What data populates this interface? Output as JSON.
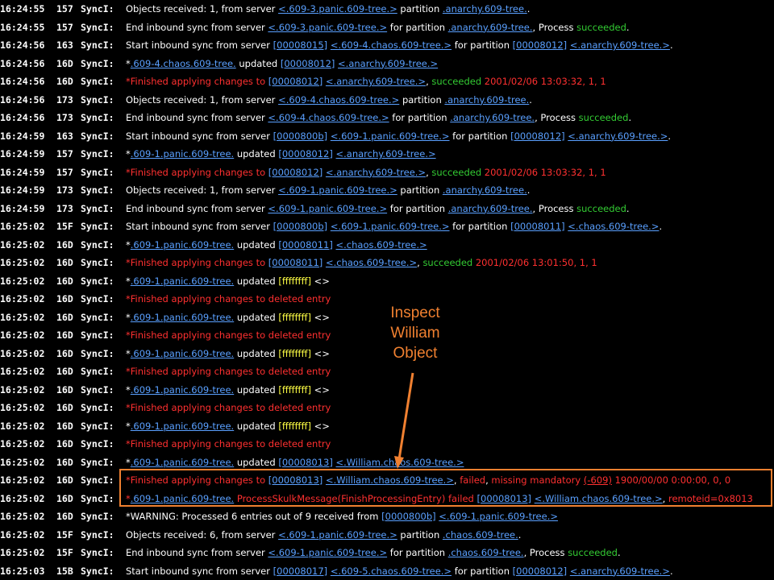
{
  "annotation": {
    "lines": [
      "Inspect",
      "William",
      "Object"
    ],
    "color": "#f08030"
  },
  "colors": {
    "link": "#5aa0ff",
    "error": "#ff3030",
    "success": "#33cc33",
    "hex": "#ffff44",
    "text": "#ffffff"
  },
  "log_rows": [
    {
      "time": "16:24:55",
      "id": "157",
      "src": "SyncI:",
      "msg": [
        [
          "w",
          "Objects received: 1, from server "
        ],
        [
          "l",
          "<.609-3.panic.609-tree.>"
        ],
        [
          "w",
          " partition "
        ],
        [
          "l",
          ".anarchy.609-tree."
        ],
        [
          "w",
          "."
        ]
      ]
    },
    {
      "time": "16:24:55",
      "id": "157",
      "src": "SyncI:",
      "msg": [
        [
          "w",
          "End inbound sync from server "
        ],
        [
          "l",
          "<.609-3.panic.609-tree.>"
        ],
        [
          "w",
          " for partition "
        ],
        [
          "l",
          ".anarchy.609-tree."
        ],
        [
          "w",
          ", Process "
        ],
        [
          "g",
          "succeeded"
        ],
        [
          "w",
          "."
        ]
      ]
    },
    {
      "time": "16:24:56",
      "id": "163",
      "src": "SyncI:",
      "msg": [
        [
          "w",
          "Start inbound sync from server "
        ],
        [
          "l",
          "[00008015]"
        ],
        [
          "w",
          " "
        ],
        [
          "l",
          "<.609-4.chaos.609-tree.>"
        ],
        [
          "w",
          " for partition "
        ],
        [
          "l",
          "[00008012]"
        ],
        [
          "w",
          " "
        ],
        [
          "l",
          "<.anarchy.609-tree.>"
        ],
        [
          "w",
          "."
        ]
      ]
    },
    {
      "time": "16:24:56",
      "id": "16D",
      "src": "SyncI:",
      "msg": [
        [
          "w",
          "*"
        ],
        [
          "l",
          ".609-4.chaos.609-tree."
        ],
        [
          "w",
          " updated "
        ],
        [
          "l",
          "[00008012]"
        ],
        [
          "w",
          " "
        ],
        [
          "l",
          "<.anarchy.609-tree.>"
        ]
      ]
    },
    {
      "time": "16:24:56",
      "id": "16D",
      "src": "SyncI:",
      "msg": [
        [
          "r",
          "*Finished applying changes to "
        ],
        [
          "l",
          "[00008012]"
        ],
        [
          "w",
          " "
        ],
        [
          "l",
          "<.anarchy.609-tree.>"
        ],
        [
          "w",
          ", "
        ],
        [
          "g",
          "succeeded"
        ],
        [
          "r",
          " 2001/02/06 13:03:32, 1, 1"
        ]
      ]
    },
    {
      "time": "16:24:56",
      "id": "173",
      "src": "SyncI:",
      "msg": [
        [
          "w",
          "Objects received: 1, from server "
        ],
        [
          "l",
          "<.609-4.chaos.609-tree.>"
        ],
        [
          "w",
          " partition "
        ],
        [
          "l",
          ".anarchy.609-tree."
        ],
        [
          "w",
          "."
        ]
      ]
    },
    {
      "time": "16:24:56",
      "id": "173",
      "src": "SyncI:",
      "msg": [
        [
          "w",
          "End inbound sync from server "
        ],
        [
          "l",
          "<.609-4.chaos.609-tree.>"
        ],
        [
          "w",
          " for partition "
        ],
        [
          "l",
          ".anarchy.609-tree."
        ],
        [
          "w",
          ", Process "
        ],
        [
          "g",
          "succeeded"
        ],
        [
          "w",
          "."
        ]
      ]
    },
    {
      "time": "16:24:59",
      "id": "163",
      "src": "SyncI:",
      "msg": [
        [
          "w",
          "Start inbound sync from server "
        ],
        [
          "l",
          "[0000800b]"
        ],
        [
          "w",
          " "
        ],
        [
          "l",
          "<.609-1.panic.609-tree.>"
        ],
        [
          "w",
          " for partition "
        ],
        [
          "l",
          "[00008012]"
        ],
        [
          "w",
          " "
        ],
        [
          "l",
          "<.anarchy.609-tree.>"
        ],
        [
          "w",
          "."
        ]
      ]
    },
    {
      "time": "16:24:59",
      "id": "157",
      "src": "SyncI:",
      "msg": [
        [
          "w",
          "*"
        ],
        [
          "l",
          ".609-1.panic.609-tree."
        ],
        [
          "w",
          " updated "
        ],
        [
          "l",
          "[00008012]"
        ],
        [
          "w",
          " "
        ],
        [
          "l",
          "<.anarchy.609-tree.>"
        ]
      ]
    },
    {
      "time": "16:24:59",
      "id": "157",
      "src": "SyncI:",
      "msg": [
        [
          "r",
          "*Finished applying changes to "
        ],
        [
          "l",
          "[00008012]"
        ],
        [
          "w",
          " "
        ],
        [
          "l",
          "<.anarchy.609-tree.>"
        ],
        [
          "w",
          ", "
        ],
        [
          "g",
          "succeeded"
        ],
        [
          "r",
          " 2001/02/06 13:03:32, 1, 1"
        ]
      ]
    },
    {
      "time": "16:24:59",
      "id": "173",
      "src": "SyncI:",
      "msg": [
        [
          "w",
          "Objects received: 1, from server "
        ],
        [
          "l",
          "<.609-1.panic.609-tree.>"
        ],
        [
          "w",
          " partition "
        ],
        [
          "l",
          ".anarchy.609-tree."
        ],
        [
          "w",
          "."
        ]
      ]
    },
    {
      "time": "16:24:59",
      "id": "173",
      "src": "SyncI:",
      "msg": [
        [
          "w",
          "End inbound sync from server "
        ],
        [
          "l",
          "<.609-1.panic.609-tree.>"
        ],
        [
          "w",
          " for partition "
        ],
        [
          "l",
          ".anarchy.609-tree."
        ],
        [
          "w",
          ", Process "
        ],
        [
          "g",
          "succeeded"
        ],
        [
          "w",
          "."
        ]
      ]
    },
    {
      "time": "16:25:02",
      "id": "15F",
      "src": "SyncI:",
      "msg": [
        [
          "w",
          "Start inbound sync from server "
        ],
        [
          "l",
          "[0000800b]"
        ],
        [
          "w",
          " "
        ],
        [
          "l",
          "<.609-1.panic.609-tree.>"
        ],
        [
          "w",
          " for partition "
        ],
        [
          "l",
          "[00008011]"
        ],
        [
          "w",
          " "
        ],
        [
          "l",
          "<.chaos.609-tree.>"
        ],
        [
          "w",
          "."
        ]
      ]
    },
    {
      "time": "16:25:02",
      "id": "16D",
      "src": "SyncI:",
      "msg": [
        [
          "w",
          "*"
        ],
        [
          "l",
          ".609-1.panic.609-tree."
        ],
        [
          "w",
          " updated "
        ],
        [
          "l",
          "[00008011]"
        ],
        [
          "w",
          " "
        ],
        [
          "l",
          "<.chaos.609-tree.>"
        ]
      ]
    },
    {
      "time": "16:25:02",
      "id": "16D",
      "src": "SyncI:",
      "msg": [
        [
          "r",
          "*Finished applying changes to "
        ],
        [
          "l",
          "[00008011]"
        ],
        [
          "w",
          " "
        ],
        [
          "l",
          "<.chaos.609-tree.>"
        ],
        [
          "w",
          ", "
        ],
        [
          "g",
          "succeeded"
        ],
        [
          "r",
          " 2001/02/06 13:01:50, 1, 1"
        ]
      ]
    },
    {
      "time": "16:25:02",
      "id": "16D",
      "src": "SyncI:",
      "msg": [
        [
          "w",
          "*"
        ],
        [
          "l",
          ".609-1.panic.609-tree."
        ],
        [
          "w",
          " updated "
        ],
        [
          "y",
          "[ffffffff]"
        ],
        [
          "w",
          " <>"
        ]
      ]
    },
    {
      "time": "16:25:02",
      "id": "16D",
      "src": "SyncI:",
      "msg": [
        [
          "r",
          "*Finished applying changes to deleted entry"
        ]
      ]
    },
    {
      "time": "16:25:02",
      "id": "16D",
      "src": "SyncI:",
      "msg": [
        [
          "w",
          "*"
        ],
        [
          "l",
          ".609-1.panic.609-tree."
        ],
        [
          "w",
          " updated "
        ],
        [
          "y",
          "[ffffffff]"
        ],
        [
          "w",
          " <>"
        ]
      ]
    },
    {
      "time": "16:25:02",
      "id": "16D",
      "src": "SyncI:",
      "msg": [
        [
          "r",
          "*Finished applying changes to deleted entry"
        ]
      ]
    },
    {
      "time": "16:25:02",
      "id": "16D",
      "src": "SyncI:",
      "msg": [
        [
          "w",
          "*"
        ],
        [
          "l",
          ".609-1.panic.609-tree."
        ],
        [
          "w",
          " updated "
        ],
        [
          "y",
          "[ffffffff]"
        ],
        [
          "w",
          " <>"
        ]
      ]
    },
    {
      "time": "16:25:02",
      "id": "16D",
      "src": "SyncI:",
      "msg": [
        [
          "r",
          "*Finished applying changes to deleted entry"
        ]
      ]
    },
    {
      "time": "16:25:02",
      "id": "16D",
      "src": "SyncI:",
      "msg": [
        [
          "w",
          "*"
        ],
        [
          "l",
          ".609-1.panic.609-tree."
        ],
        [
          "w",
          " updated "
        ],
        [
          "y",
          "[ffffffff]"
        ],
        [
          "w",
          " <>"
        ]
      ]
    },
    {
      "time": "16:25:02",
      "id": "16D",
      "src": "SyncI:",
      "msg": [
        [
          "r",
          "*Finished applying changes to deleted entry"
        ]
      ]
    },
    {
      "time": "16:25:02",
      "id": "16D",
      "src": "SyncI:",
      "msg": [
        [
          "w",
          "*"
        ],
        [
          "l",
          ".609-1.panic.609-tree."
        ],
        [
          "w",
          " updated "
        ],
        [
          "y",
          "[ffffffff]"
        ],
        [
          "w",
          " <>"
        ]
      ]
    },
    {
      "time": "16:25:02",
      "id": "16D",
      "src": "SyncI:",
      "msg": [
        [
          "r",
          "*Finished applying changes to deleted entry"
        ]
      ]
    },
    {
      "time": "16:25:02",
      "id": "16D",
      "src": "SyncI:",
      "msg": [
        [
          "w",
          "*"
        ],
        [
          "l",
          ".609-1.panic.609-tree."
        ],
        [
          "w",
          " updated "
        ],
        [
          "l",
          "[00008013]"
        ],
        [
          "w",
          " "
        ],
        [
          "l",
          "<.William.chaos.609-tree.>"
        ]
      ]
    },
    {
      "time": "16:25:02",
      "id": "16D",
      "src": "SyncI:",
      "msg": [
        [
          "r",
          "*Finished applying changes to "
        ],
        [
          "l",
          "[00008013]"
        ],
        [
          "w",
          " "
        ],
        [
          "l",
          "<.William.chaos.609-tree.>"
        ],
        [
          "w",
          ", "
        ],
        [
          "r",
          "failed"
        ],
        [
          "w",
          ", "
        ],
        [
          "r",
          "missing mandatory "
        ],
        [
          "ru",
          "(-609)"
        ],
        [
          "r",
          " 1900/00/00 0:00:00, 0, 0"
        ]
      ]
    },
    {
      "time": "16:25:02",
      "id": "16D",
      "src": "SyncI:",
      "msg": [
        [
          "r",
          "*"
        ],
        [
          "l",
          ".609-1.panic.609-tree."
        ],
        [
          "r",
          " ProcessSkulkMessage(FinishProcessingEntry) failed "
        ],
        [
          "l",
          "[00008013]"
        ],
        [
          "w",
          " "
        ],
        [
          "l",
          "<.William.chaos.609-tree.>"
        ],
        [
          "w",
          ", "
        ],
        [
          "r",
          "remoteid=0x8013"
        ]
      ]
    },
    {
      "time": "16:25:02",
      "id": "16D",
      "src": "SyncI:",
      "msg": [
        [
          "w",
          "*WARNING: Processed 6 entries out of 9 received from "
        ],
        [
          "l",
          "[0000800b]"
        ],
        [
          "w",
          " "
        ],
        [
          "l",
          "<.609-1.panic.609-tree.>"
        ]
      ]
    },
    {
      "time": "16:25:02",
      "id": "15F",
      "src": "SyncI:",
      "msg": [
        [
          "w",
          "Objects received: 6, from server "
        ],
        [
          "l",
          "<.609-1.panic.609-tree.>"
        ],
        [
          "w",
          " partition "
        ],
        [
          "l",
          ".chaos.609-tree."
        ],
        [
          "w",
          "."
        ]
      ]
    },
    {
      "time": "16:25:02",
      "id": "15F",
      "src": "SyncI:",
      "msg": [
        [
          "w",
          "End inbound sync from server "
        ],
        [
          "l",
          "<.609-1.panic.609-tree.>"
        ],
        [
          "w",
          " for partition "
        ],
        [
          "l",
          ".chaos.609-tree."
        ],
        [
          "w",
          ", Process "
        ],
        [
          "g",
          "succeeded"
        ],
        [
          "w",
          "."
        ]
      ]
    },
    {
      "time": "16:25:03",
      "id": "15B",
      "src": "SyncI:",
      "msg": [
        [
          "w",
          "Start inbound sync from server "
        ],
        [
          "l",
          "[00008017]"
        ],
        [
          "w",
          " "
        ],
        [
          "l",
          "<.609-5.chaos.609-tree.>"
        ],
        [
          "w",
          " for partition "
        ],
        [
          "l",
          "[00008012]"
        ],
        [
          "w",
          " "
        ],
        [
          "l",
          "<.anarchy.609-tree.>"
        ],
        [
          "w",
          "."
        ]
      ]
    }
  ]
}
